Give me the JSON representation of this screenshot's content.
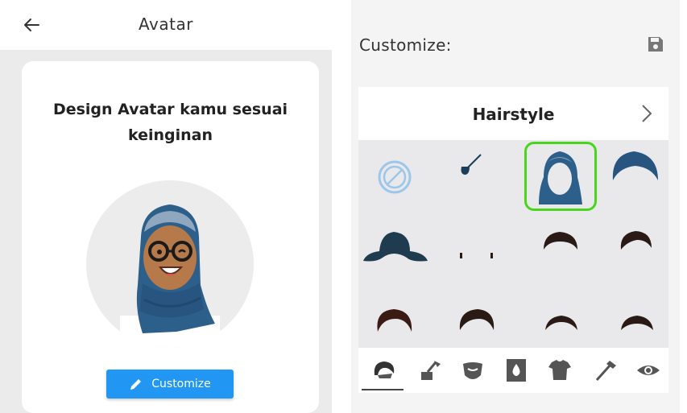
{
  "left": {
    "title": "Avatar",
    "headline_line1": "Design Avatar kamu sesuai",
    "headline_line2": "keinginan",
    "customize_label": "Customize"
  },
  "right": {
    "title": "Customize:",
    "category": "Hairstyle",
    "options": [
      "none-icon",
      "hair-pin-icon",
      "hijab-icon",
      "turban-icon",
      "wide-hat-icon",
      "sideburns-icon",
      "short-hair-icon",
      "spiky-hair-icon",
      "curly-hair-icon",
      "wavy-hair-icon",
      "thin-hair-icon",
      "bald-fringe-icon"
    ],
    "selected_option": 2,
    "tabs": [
      "hair-icon",
      "hair-color-icon",
      "beard-icon",
      "skin-tone-icon",
      "shirt-icon",
      "accessory-icon",
      "eye-icon"
    ],
    "active_tab": 0
  },
  "colors": {
    "accent": "#2196f3",
    "selected_outline": "#47d61c",
    "hijab_blue": "#2d5f8b",
    "hair_dark": "#2a1a15"
  }
}
